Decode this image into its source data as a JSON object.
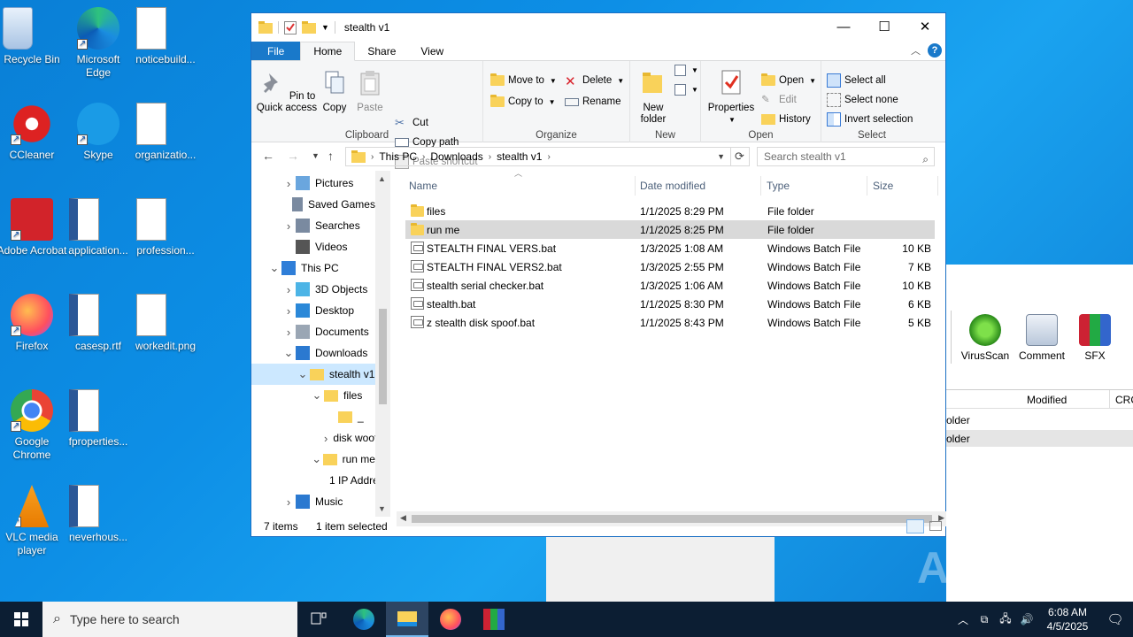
{
  "desktop": {
    "icons": [
      {
        "label": "Recycle Bin",
        "icon": "recycle-bin-icon"
      },
      {
        "label": "Microsoft Edge",
        "icon": "edge-icon"
      },
      {
        "label": "noticebuild...",
        "icon": "image-file-icon"
      },
      {
        "label": "CCleaner",
        "icon": "ccleaner-icon"
      },
      {
        "label": "Skype",
        "icon": "skype-icon"
      },
      {
        "label": "organizatio...",
        "icon": "image-file-icon"
      },
      {
        "label": "Adobe Acrobat",
        "icon": "acrobat-icon"
      },
      {
        "label": "application...",
        "icon": "word-doc-icon"
      },
      {
        "label": "profession...",
        "icon": "image-file-icon"
      },
      {
        "label": "Firefox",
        "icon": "firefox-icon"
      },
      {
        "label": "casesp.rtf",
        "icon": "word-doc-icon"
      },
      {
        "label": "workedit.png",
        "icon": "image-file-icon"
      },
      {
        "label": "Google Chrome",
        "icon": "chrome-icon"
      },
      {
        "label": "fproperties...",
        "icon": "word-doc-icon"
      },
      {
        "label": "VLC media player",
        "icon": "vlc-icon"
      },
      {
        "label": "neverhous...",
        "icon": "word-doc-icon"
      }
    ]
  },
  "explorer": {
    "title": "stealth v1",
    "tabs": {
      "file": "File",
      "home": "Home",
      "share": "Share",
      "view": "View"
    },
    "ribbon": {
      "clipboard": {
        "name": "Clipboard",
        "pin": "Pin to Quick access",
        "copy": "Copy",
        "paste": "Paste",
        "cut": "Cut",
        "copy_path": "Copy path",
        "paste_shortcut": "Paste shortcut"
      },
      "organize": {
        "name": "Organize",
        "move_to": "Move to",
        "copy_to": "Copy to",
        "delete": "Delete",
        "rename": "Rename"
      },
      "new": {
        "name": "New",
        "new_folder": "New folder"
      },
      "open": {
        "name": "Open",
        "properties": "Properties",
        "open": "Open",
        "edit": "Edit",
        "history": "History"
      },
      "select": {
        "name": "Select",
        "select_all": "Select all",
        "select_none": "Select none",
        "invert": "Invert selection"
      }
    },
    "address": {
      "crumbs": [
        "This PC",
        "Downloads",
        "stealth v1"
      ],
      "search_placeholder": "Search stealth v1"
    },
    "nav": [
      {
        "label": "Pictures",
        "chev": ">",
        "indent": 1,
        "icon": "pictures-icon"
      },
      {
        "label": "Saved Games",
        "chev": "",
        "indent": 1,
        "icon": "saved-games-icon"
      },
      {
        "label": "Searches",
        "chev": ">",
        "indent": 1,
        "icon": "searches-icon"
      },
      {
        "label": "Videos",
        "chev": "",
        "indent": 1,
        "icon": "videos-icon"
      },
      {
        "label": "This PC",
        "chev": "v",
        "indent": 0,
        "icon": "this-pc-icon"
      },
      {
        "label": "3D Objects",
        "chev": ">",
        "indent": 1,
        "icon": "3d-objects-icon"
      },
      {
        "label": "Desktop",
        "chev": ">",
        "indent": 1,
        "icon": "desktop-icon"
      },
      {
        "label": "Documents",
        "chev": ">",
        "indent": 1,
        "icon": "documents-icon"
      },
      {
        "label": "Downloads",
        "chev": "v",
        "indent": 1,
        "icon": "downloads-icon"
      },
      {
        "label": "stealth v1",
        "chev": "v",
        "indent": 2,
        "icon": "folder-icon",
        "selected": true
      },
      {
        "label": "files",
        "chev": "v",
        "indent": 3,
        "icon": "folder-icon"
      },
      {
        "label": "_",
        "chev": "",
        "indent": 4,
        "icon": "folder-icon"
      },
      {
        "label": "disk woof",
        "chev": ">",
        "indent": 4,
        "icon": "folder-icon"
      },
      {
        "label": "run me",
        "chev": "v",
        "indent": 3,
        "icon": "folder-icon"
      },
      {
        "label": "1 IP Addre",
        "chev": "",
        "indent": 4,
        "icon": "folder-icon"
      },
      {
        "label": "Music",
        "chev": ">",
        "indent": 1,
        "icon": "music-icon"
      }
    ],
    "columns": {
      "name": "Name",
      "date": "Date modified",
      "type": "Type",
      "size": "Size"
    },
    "files": [
      {
        "name": "files",
        "date": "1/1/2025 8:29 PM",
        "type": "File folder",
        "size": "",
        "kind": "folder"
      },
      {
        "name": "run me",
        "date": "1/1/2025 8:25 PM",
        "type": "File folder",
        "size": "",
        "kind": "folder",
        "selected": true
      },
      {
        "name": "STEALTH FINAL VERS.bat",
        "date": "1/3/2025 1:08 AM",
        "type": "Windows Batch File",
        "size": "10 KB",
        "kind": "bat"
      },
      {
        "name": "STEALTH FINAL VERS2.bat",
        "date": "1/3/2025 2:55 PM",
        "type": "Windows Batch File",
        "size": "7 KB",
        "kind": "bat"
      },
      {
        "name": "stealth serial checker.bat",
        "date": "1/3/2025 1:06 AM",
        "type": "Windows Batch File",
        "size": "10 KB",
        "kind": "bat"
      },
      {
        "name": "stealth.bat",
        "date": "1/1/2025 8:30 PM",
        "type": "Windows Batch File",
        "size": "6 KB",
        "kind": "bat"
      },
      {
        "name": "z stealth disk spoof.bat",
        "date": "1/1/2025 8:43 PM",
        "type": "Windows Batch File",
        "size": "5 KB",
        "kind": "bat"
      }
    ],
    "status": {
      "count": "7 items",
      "selection": "1 item selected"
    }
  },
  "archiver": {
    "tools": [
      "VirusScan",
      "Comment",
      "SFX"
    ],
    "columns": {
      "modified": "Modified",
      "crc": "CRC"
    },
    "rows": [
      "older",
      "older"
    ]
  },
  "taskbar": {
    "search_placeholder": "Type here to search",
    "time": "6:08 AM",
    "date": "4/5/2025"
  },
  "watermark": "ANY RUN",
  "colors": {
    "accent": "#1979ca",
    "selection": "#cce8ff",
    "row_selected": "#d9d9d9",
    "taskbar": "#0c1e33"
  }
}
